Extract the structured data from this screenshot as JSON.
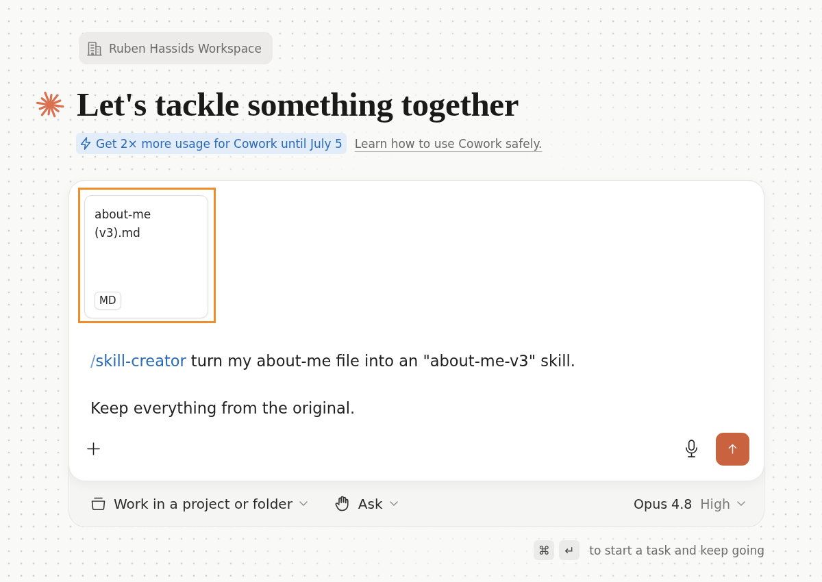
{
  "workspace": {
    "label": "Ruben Hassids Workspace"
  },
  "heading": "Let's tackle something together",
  "promo": {
    "label": "Get 2× more usage for Cowork until July 5"
  },
  "safety_link": {
    "label": "Learn how to use Cowork safely."
  },
  "composer": {
    "attachments": [
      {
        "name": "about-me (v3).md",
        "type": "MD",
        "highlighted": true
      }
    ],
    "message": [
      {
        "command": {
          "prefix": "/",
          "name": "skill-creator"
        },
        "text": "turn my about-me file into an \"about-me-v3\" skill."
      },
      {
        "text": "Keep everything from the original."
      }
    ],
    "project": {
      "label": "Work in a project or folder"
    },
    "mode": {
      "label": "Ask"
    },
    "model": {
      "name": "Opus 4.8",
      "effort": "High"
    }
  },
  "shortcut_hint": {
    "keys": [
      "⌘",
      "↵"
    ],
    "text": "to start a task and keep going"
  }
}
